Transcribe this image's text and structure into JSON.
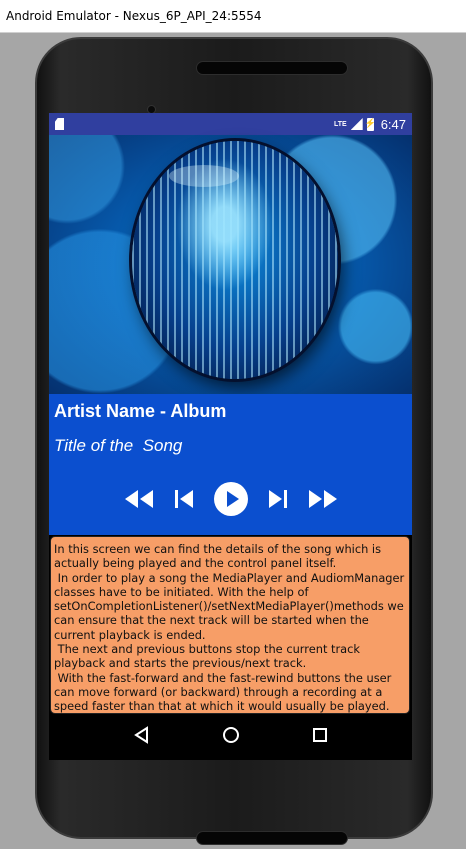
{
  "window": {
    "title": "Android Emulator - Nexus_6P_API_24:5554"
  },
  "status_bar": {
    "network": "LTE",
    "time": "6:47"
  },
  "player": {
    "artist_album": "Artist Name - Album",
    "song_title": "Title of the  Song",
    "controls": [
      "fast-rewind",
      "skip-previous",
      "play",
      "skip-next",
      "fast-forward"
    ]
  },
  "description": {
    "paragraphs": [
      "In this screen we can find the details of the song which is actually being played and the control panel itself.",
      " In order to play a song the MediaPlayer and AudiomManager classes have to be initiated. With the help of setOnCompletionListener()/setNextMediaPlayer()methods we can ensure that the next track will be started when the current playback is ended.",
      " The next and previous buttons stop the current track playback and starts the previous/next track.",
      " With the fast-forward and the fast-rewind buttons the user can move forward (or backward) through a recording at a speed faster than that at which it would usually be played."
    ]
  },
  "colors": {
    "status_bar": "#303f9f",
    "info_panel": "#0b4fcf",
    "description_bg": "#f79e67"
  }
}
